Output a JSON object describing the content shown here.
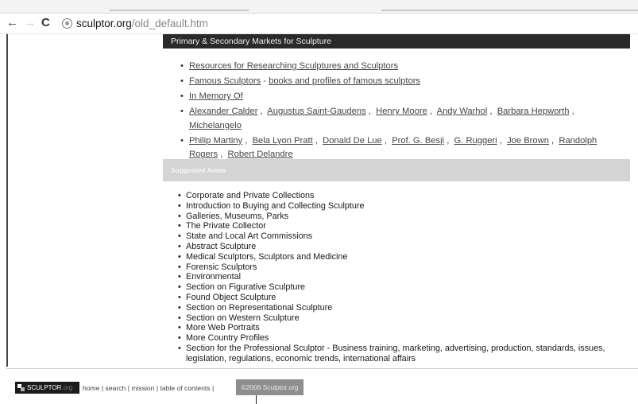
{
  "browser": {
    "back_icon": "←",
    "forward_icon": "→",
    "reload_icon": "C",
    "url_domain": "sculptor.org",
    "url_path": "/old_default.htm"
  },
  "markets": {
    "title": "Primary & Secondary Markets for Sculpture",
    "items": [
      {
        "link": "Resources for Researching Sculptures and Sculptors"
      },
      {
        "link": "Famous Sculptors",
        "sep": " - ",
        "link2": "books and profiles of famous sculptors"
      },
      {
        "link": "In Memory Of"
      }
    ],
    "artists": [
      "Alexander Calder",
      "Augustus Saint-Gaudens",
      "Henry Moore",
      "Andy Warhol",
      "Barbara Hepworth",
      "Michelangelo"
    ],
    "sculptors": [
      "Philip Martiny",
      "Bela Lyon Pratt",
      "Donald De Lue",
      "Prof. G. Besji",
      "G. Ruggeri",
      "Joe Brown",
      "Randolph Rogers",
      "Robert Delandre"
    ]
  },
  "suggested": {
    "title": "Suggested Areas",
    "items": [
      "Corporate and Private Collections",
      "Introduction to Buying and Collecting Sculpture",
      "Galleries, Museums, Parks",
      "The Private Collector",
      "State and Local Art Commissions",
      "Abstract Sculpture",
      "Medical Sculptors, Sculptors and Medicine",
      "Forensic Sculptors",
      "Environmental",
      "Section on Figurative Sculpture",
      "Found Object Sculpture",
      "Section on Representational Sculpture",
      "Section on Western Sculpture",
      "More Web Portraits",
      "More Country Profiles",
      "Section for the Professional Sculptor - Business training, marketing, advertising, production, standards, issues, legislation, regulations, economic trends, international affairs"
    ]
  },
  "footer": {
    "logo_main": "SCULPTOR",
    "logo_suffix": ".org",
    "links": [
      "home",
      "search",
      "mission",
      "table of contents"
    ],
    "copyright": "©2006 Sculptor.org"
  }
}
